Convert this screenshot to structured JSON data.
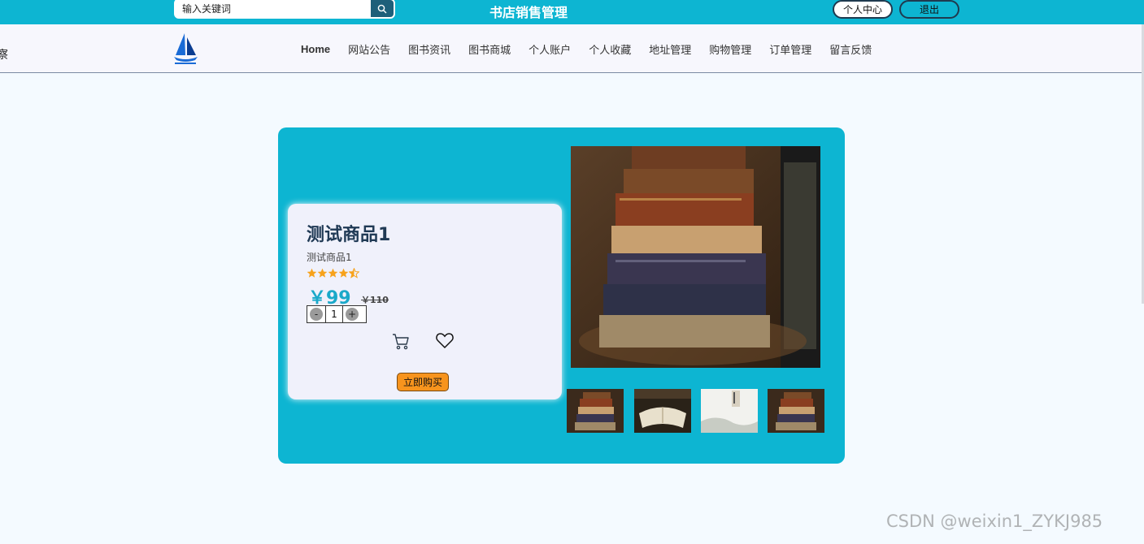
{
  "header": {
    "search_placeholder": "输入关键词",
    "site_title": "书店销售管理",
    "user_center_label": "个人中心",
    "logout_label": "退出"
  },
  "nav": {
    "edge_text": "察",
    "items": [
      "Home",
      "网站公告",
      "图书资讯",
      "图书商城",
      "个人账户",
      "个人收藏",
      "地址管理",
      "购物管理",
      "订单管理",
      "留言反馈"
    ]
  },
  "product": {
    "title": "测试商品1",
    "description": "测试商品1",
    "rating": 4.5,
    "rating_max": 5,
    "price": "￥99",
    "original_price": "￥110",
    "quantity": "1",
    "decrement_label": "-",
    "increment_label": "+",
    "buy_label": "立即购买"
  },
  "watermark": "CSDN @weixin1_ZYKJ985",
  "colors": {
    "accent": "#0db5d2",
    "buy_button": "#f7941d",
    "star": "#f7a21b",
    "price": "#1aa9c9"
  }
}
